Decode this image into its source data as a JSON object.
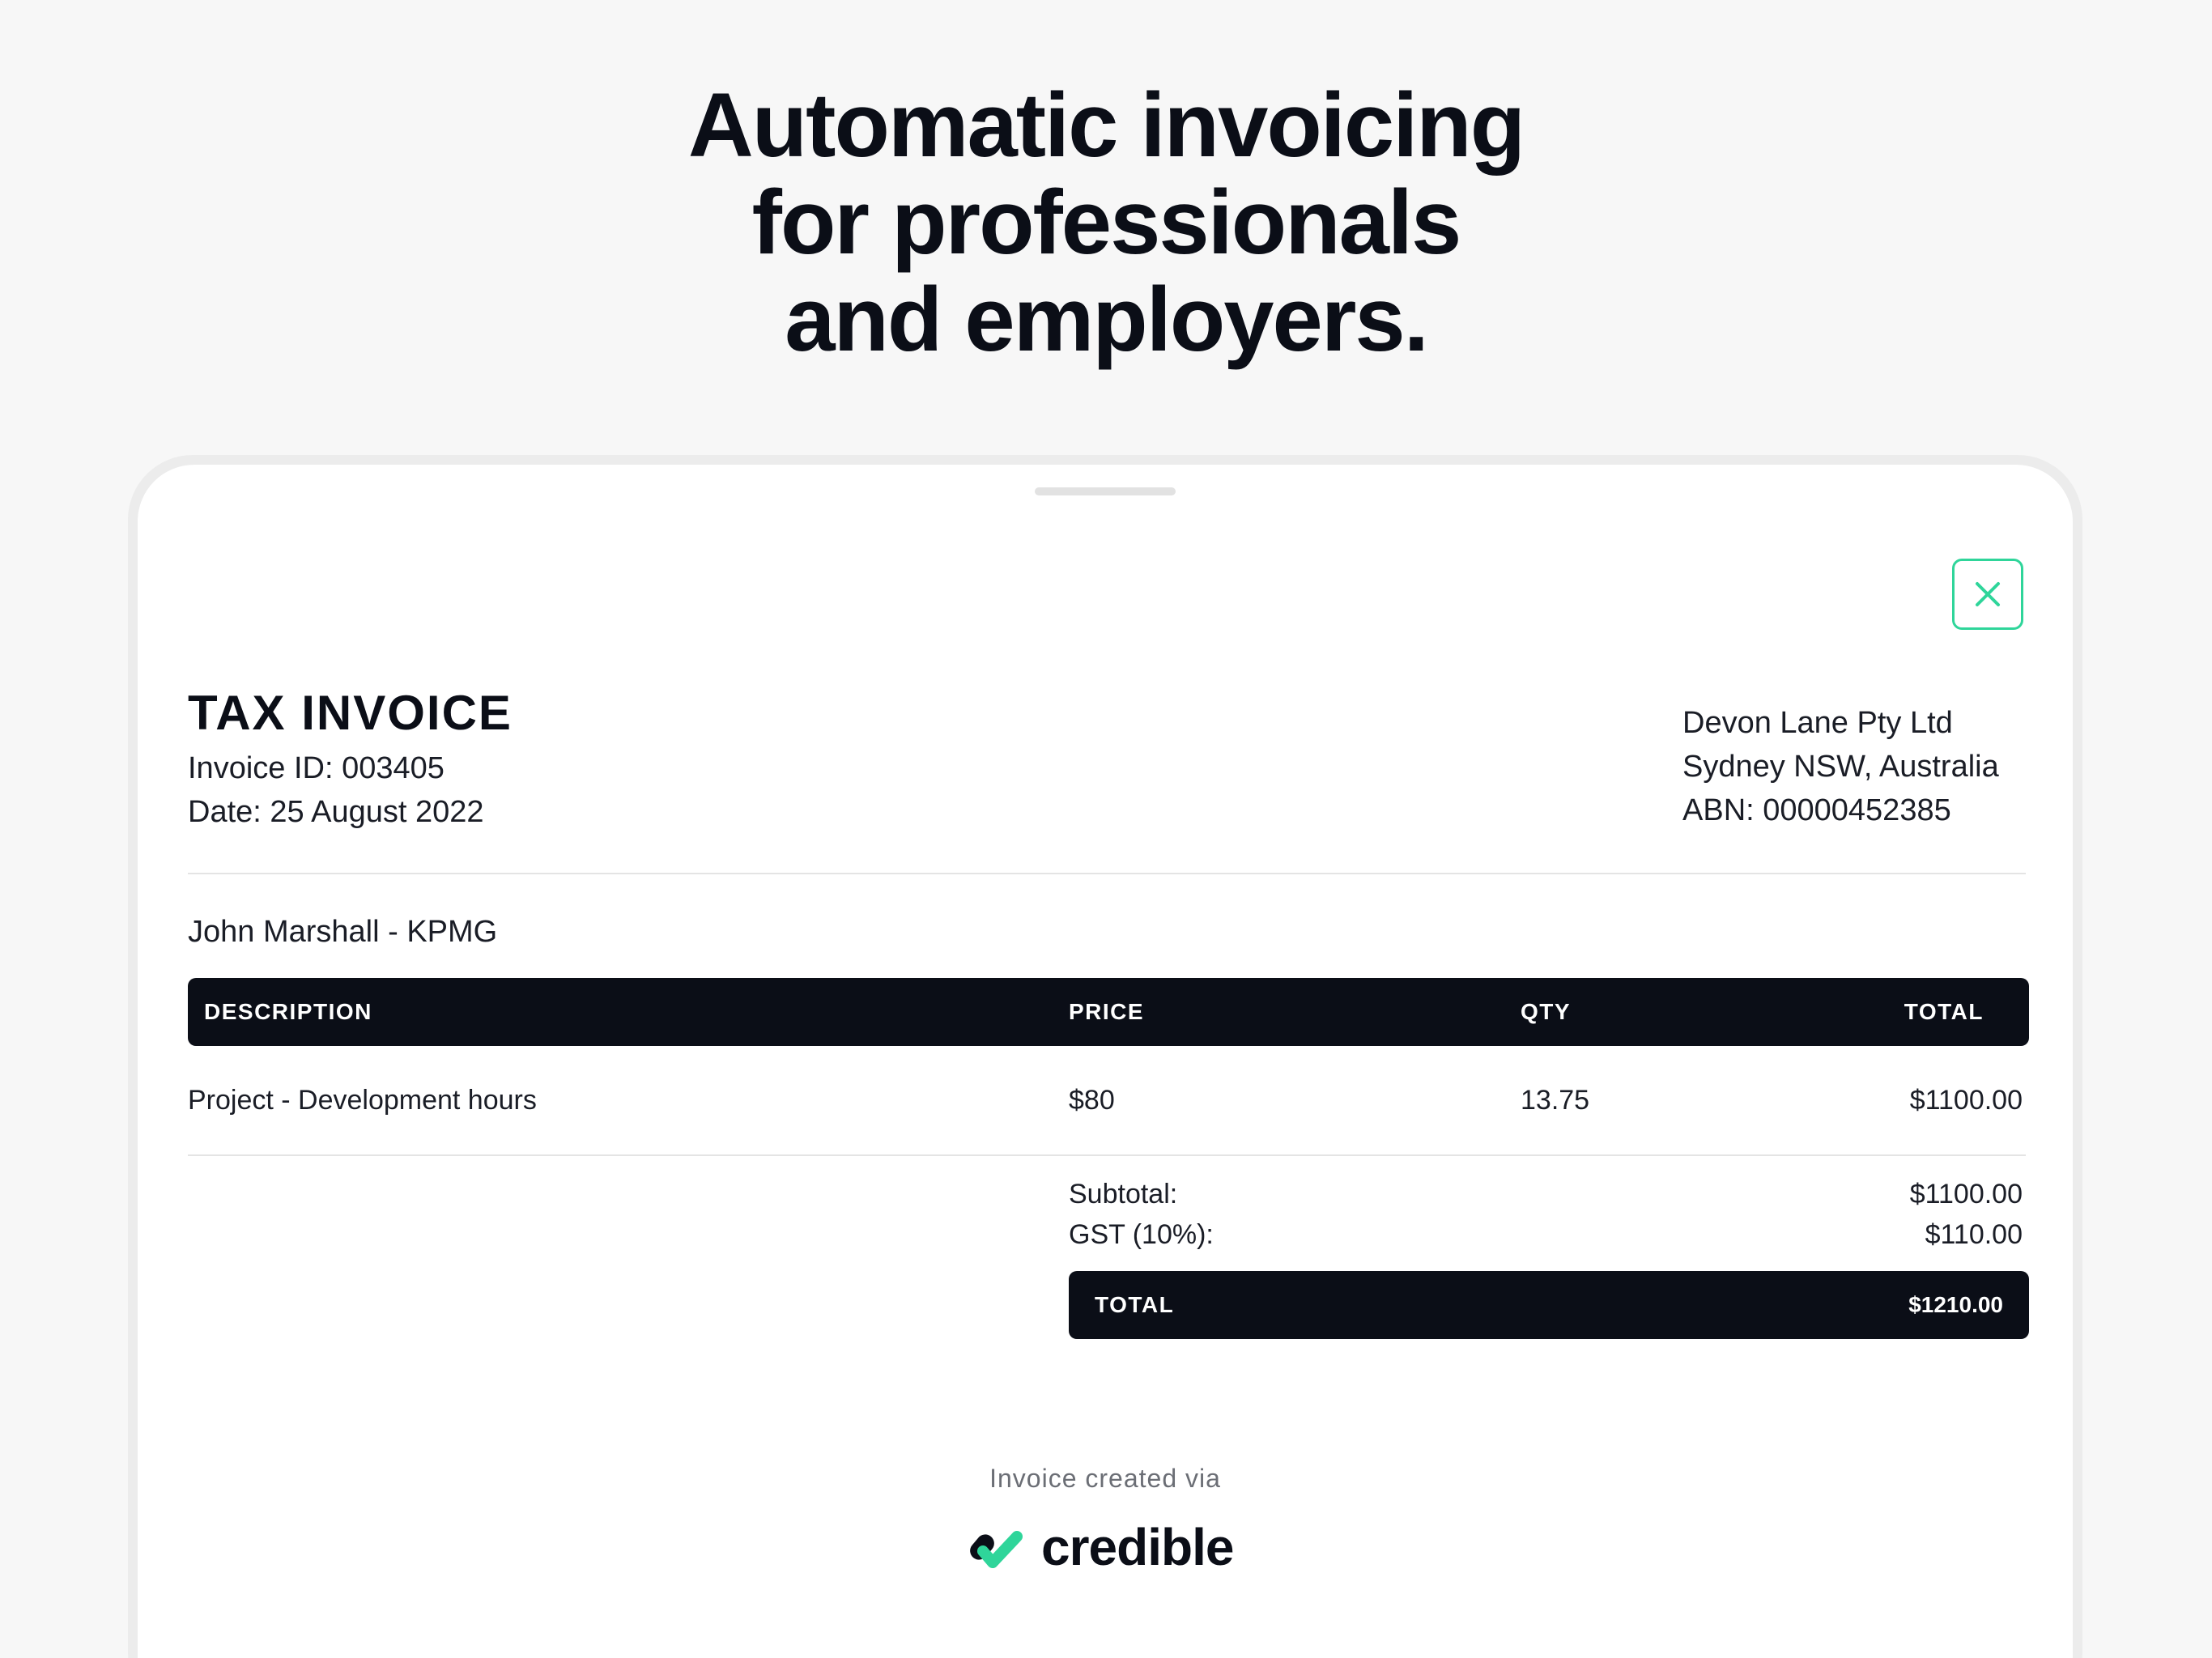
{
  "headline": {
    "line1": "Automatic invoicing",
    "line2": "for professionals",
    "line3": "and employers."
  },
  "invoice": {
    "title": "TAX INVOICE",
    "invoice_id": "Invoice ID: 003405",
    "date": "Date: 25 August 2022",
    "company": {
      "name": "Devon Lane Pty Ltd",
      "location": "Sydney NSW, Australia",
      "abn": "ABN: 00000452385"
    },
    "client": "John Marshall - KPMG",
    "table": {
      "headers": [
        "DESCRIPTION",
        "PRICE",
        "QTY",
        "TOTAL"
      ],
      "rows": [
        {
          "description": "Project - Development hours",
          "price": "$80",
          "qty": "13.75",
          "total": "$1100.00"
        }
      ]
    },
    "summary": {
      "subtotal_label": "Subtotal:",
      "subtotal_value": "$1100.00",
      "gst_label": "GST (10%):",
      "gst_value": "$110.00",
      "total_label": "TOTAL",
      "total_value": "$1210.00"
    },
    "footer": {
      "note": "Invoice created via",
      "brand": "credible"
    }
  },
  "icons": {
    "close": "close-icon",
    "logo": "credible-logo-icon"
  },
  "colors": {
    "accent": "#2fd59a",
    "dark": "#0b0e17"
  }
}
